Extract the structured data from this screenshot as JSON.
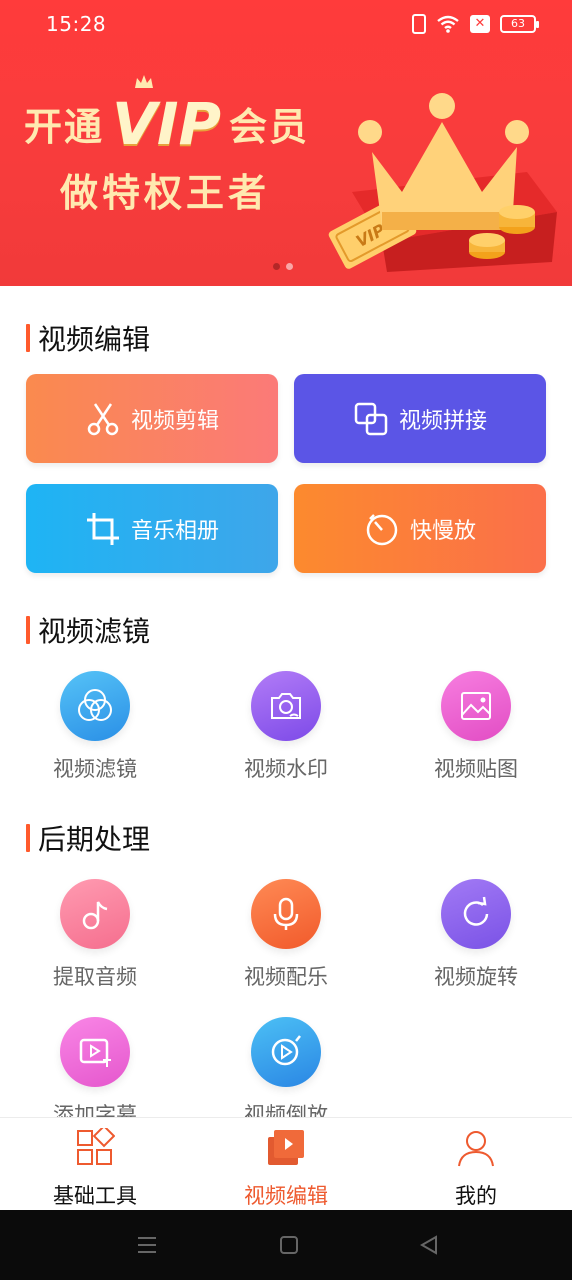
{
  "status_bar": {
    "time": "15:28",
    "battery": "63"
  },
  "banner": {
    "line1_prefix": "开通",
    "line1_vip": "VIP",
    "line1_suffix": "会员",
    "line2": "做特权王者",
    "ticket_text": "VIP",
    "page_count": 2,
    "active_page": 1
  },
  "sections": {
    "edit": {
      "title": "视频编辑"
    },
    "filter": {
      "title": "视频滤镜"
    },
    "post": {
      "title": "后期处理"
    }
  },
  "edit_buttons": [
    {
      "label": "视频剪辑",
      "icon": "scissors-icon"
    },
    {
      "label": "视频拼接",
      "icon": "overlap-squares-icon"
    },
    {
      "label": "音乐相册",
      "icon": "crop-icon"
    },
    {
      "label": "快慢放",
      "icon": "timer-icon"
    }
  ],
  "filter_tiles": [
    {
      "label": "视频滤镜",
      "icon": "filter-circles-icon"
    },
    {
      "label": "视频水印",
      "icon": "camera-watermark-icon"
    },
    {
      "label": "视频贴图",
      "icon": "image-icon"
    }
  ],
  "post_tiles": [
    {
      "label": "提取音频",
      "icon": "music-note-icon"
    },
    {
      "label": "视频配乐",
      "icon": "microphone-icon"
    },
    {
      "label": "视频旋转",
      "icon": "rotate-icon"
    },
    {
      "label": "添加字幕",
      "icon": "subtitle-icon"
    },
    {
      "label": "视频倒放",
      "icon": "reverse-play-icon"
    }
  ],
  "tabs": [
    {
      "label": "基础工具",
      "icon": "grid-tools-icon",
      "active": false
    },
    {
      "label": "视频编辑",
      "icon": "video-edit-icon",
      "active": true
    },
    {
      "label": "我的",
      "icon": "user-icon",
      "active": false
    }
  ],
  "colors": {
    "banner": "#ff3b3b",
    "accent": "#ee5a2f",
    "btn_cut": "#fa7a5a",
    "btn_join": "#5b55e6",
    "btn_album": "#2ab0f0",
    "btn_speed": "#fb7a3d"
  }
}
